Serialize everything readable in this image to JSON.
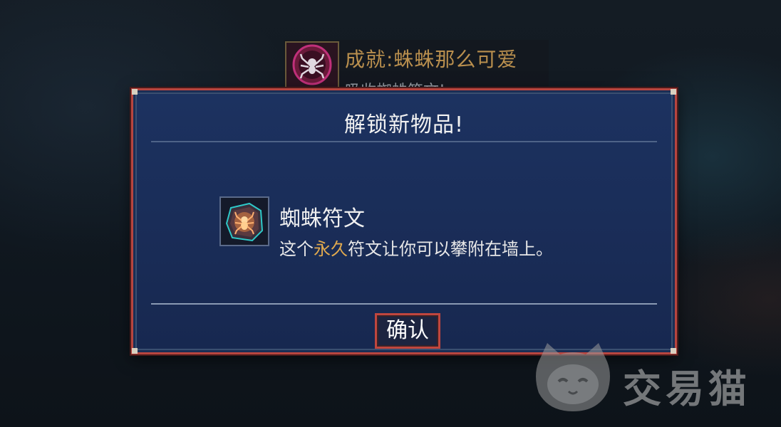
{
  "achievement": {
    "title": "成就:蛛蛛那么可爱",
    "subtitle": "吸收蜘蛛符文!",
    "icon": "spider-icon"
  },
  "dialog": {
    "title": "解锁新物品!",
    "item": {
      "name": "蜘蛛符文",
      "icon": "spider-rune-icon",
      "description_pre": "这个",
      "description_highlight": "永久",
      "description_post": "符文让你可以攀附在墙上。"
    },
    "confirm_label": "确认"
  },
  "colors": {
    "dialog_bg": "#1a2e55",
    "dialog_border": "#b8453f",
    "highlight": "#e0a94e",
    "achievement_title": "#b98f4e"
  },
  "watermark": {
    "text": "交易猫",
    "icon": "cat-logo-icon"
  }
}
